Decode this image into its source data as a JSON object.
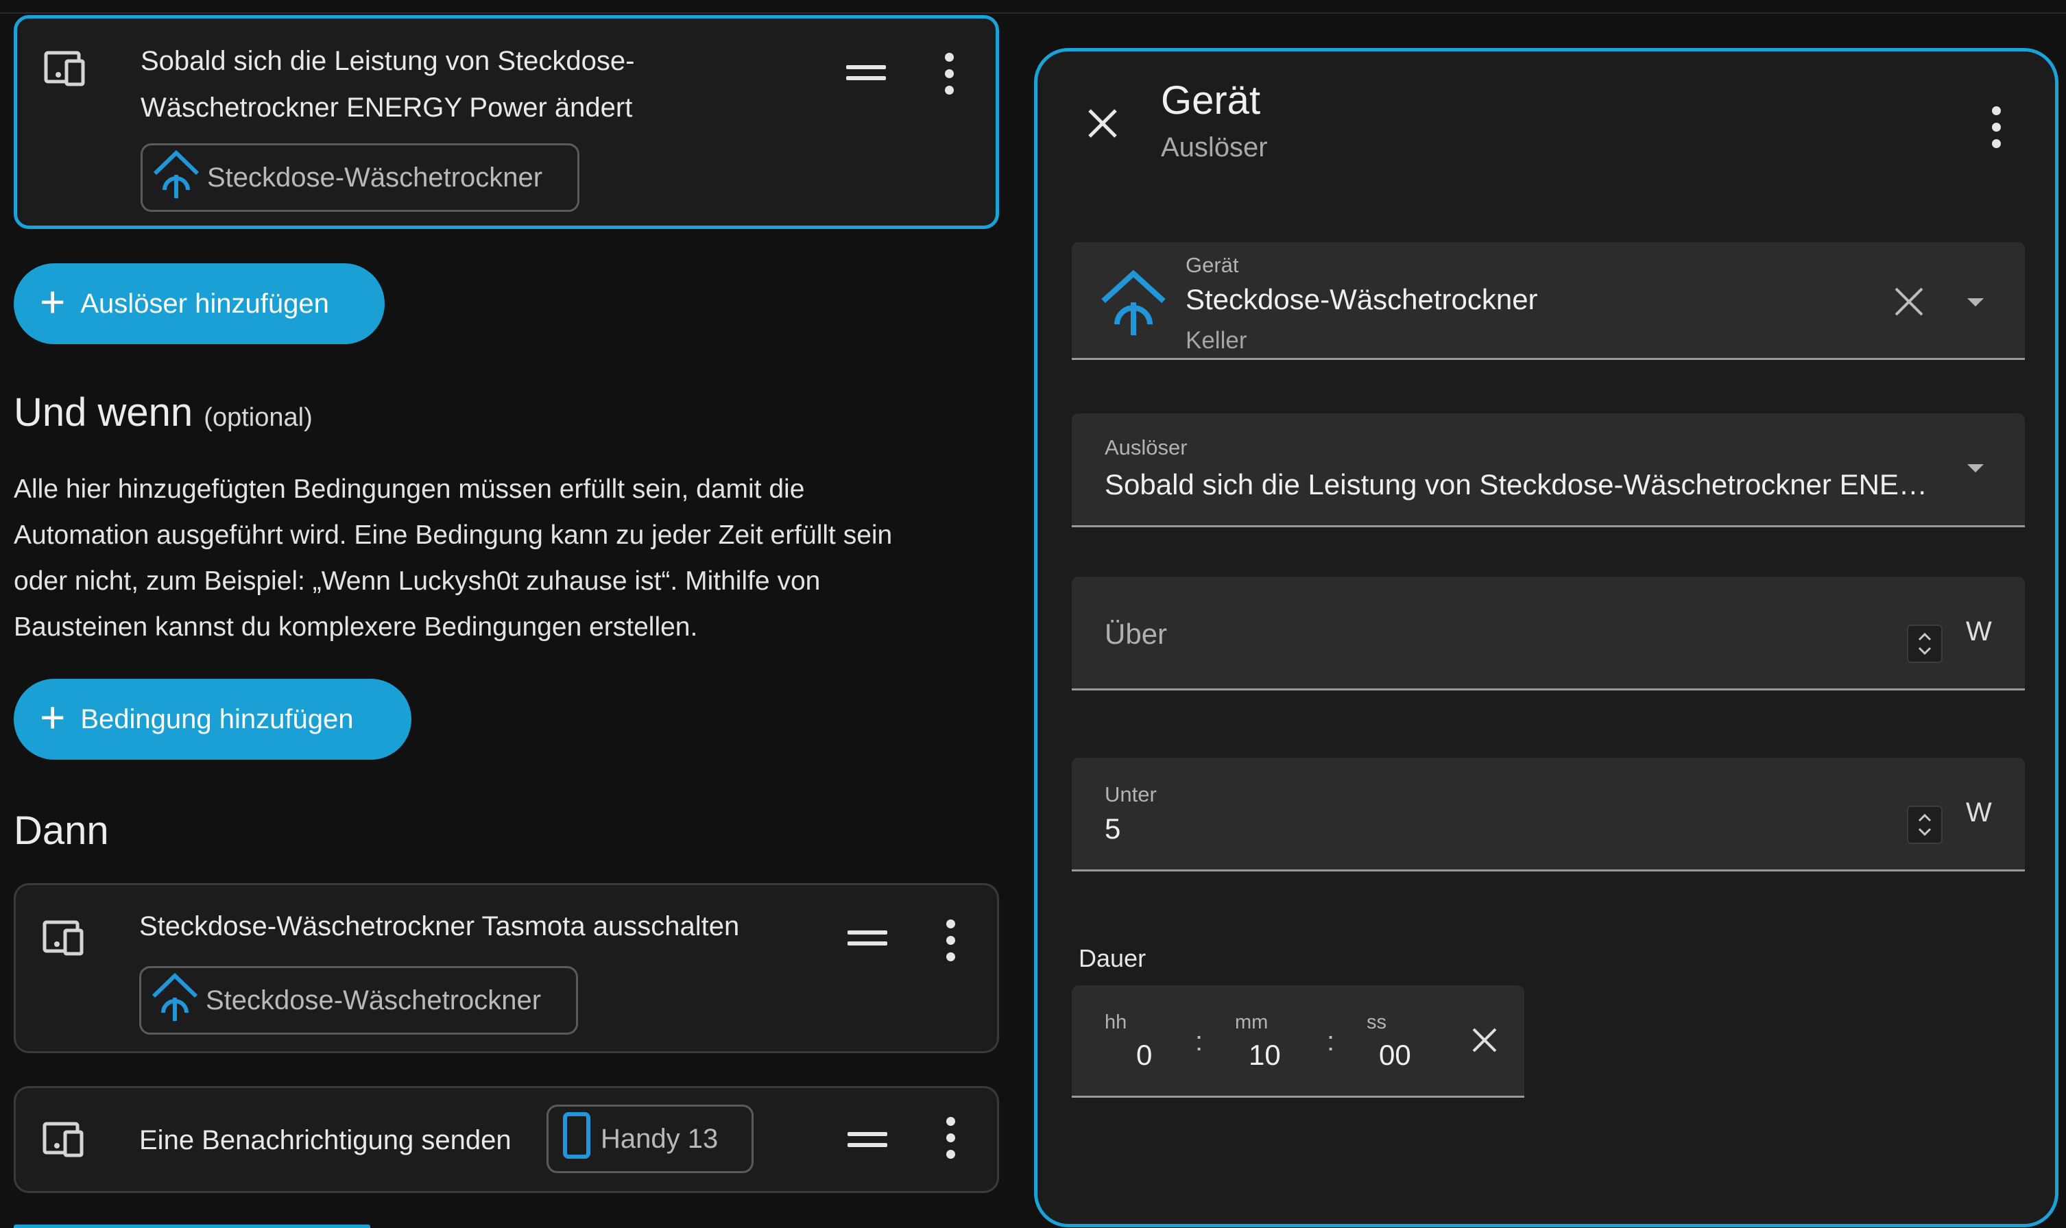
{
  "trigger_card": {
    "title_line1": "Sobald sich die Leistung von Steckdose-",
    "title_line2": "Wäschetrockner ENERGY Power ändert",
    "chip_label": "Steckdose-Wäschetrockner"
  },
  "add_trigger_button": "Auslöser hinzufügen",
  "conditions": {
    "heading": "Und wenn",
    "heading_suffix": "(optional)",
    "description_lines": [
      "Alle hier hinzugefügten Bedingungen müssen erfüllt sein, damit die",
      "Automation ausgeführt wird. Eine Bedingung kann zu jeder Zeit erfüllt sein",
      "oder nicht, zum Beispiel: „Wenn Luckysh0t zuhause ist“. Mithilfe von",
      "Bausteinen kannst du komplexere Bedingungen erstellen."
    ],
    "add_button": "Bedingung hinzufügen"
  },
  "actions": {
    "heading": "Dann",
    "items": [
      {
        "title": "Steckdose-Wäschetrockner Tasmota ausschalten",
        "chip_label": "Steckdose-Wäschetrockner"
      },
      {
        "title": "Eine Benachrichtigung senden",
        "chip_label": "Handy 13"
      }
    ]
  },
  "dialog": {
    "title": "Gerät",
    "subtitle": "Auslöser",
    "device_field": {
      "label": "Gerät",
      "value": "Steckdose-Wäschetrockner",
      "area": "Keller"
    },
    "trigger_field": {
      "label": "Auslöser",
      "value": "Sobald sich die Leistung von Steckdose-Wäschetrockner ENE…"
    },
    "above_field": {
      "placeholder": "Über",
      "unit": "W"
    },
    "below_field": {
      "label": "Unter",
      "value": "5",
      "unit": "W"
    },
    "duration": {
      "label": "Dauer",
      "hh_label": "hh",
      "hh": "0",
      "mm_label": "mm",
      "mm": "10",
      "ss_label": "ss",
      "ss": "00",
      "separator": ":"
    }
  },
  "colors": {
    "accent": "#1aa3d6",
    "background": "#111111",
    "card": "#1c1c1c",
    "field": "#2c2c2c"
  }
}
